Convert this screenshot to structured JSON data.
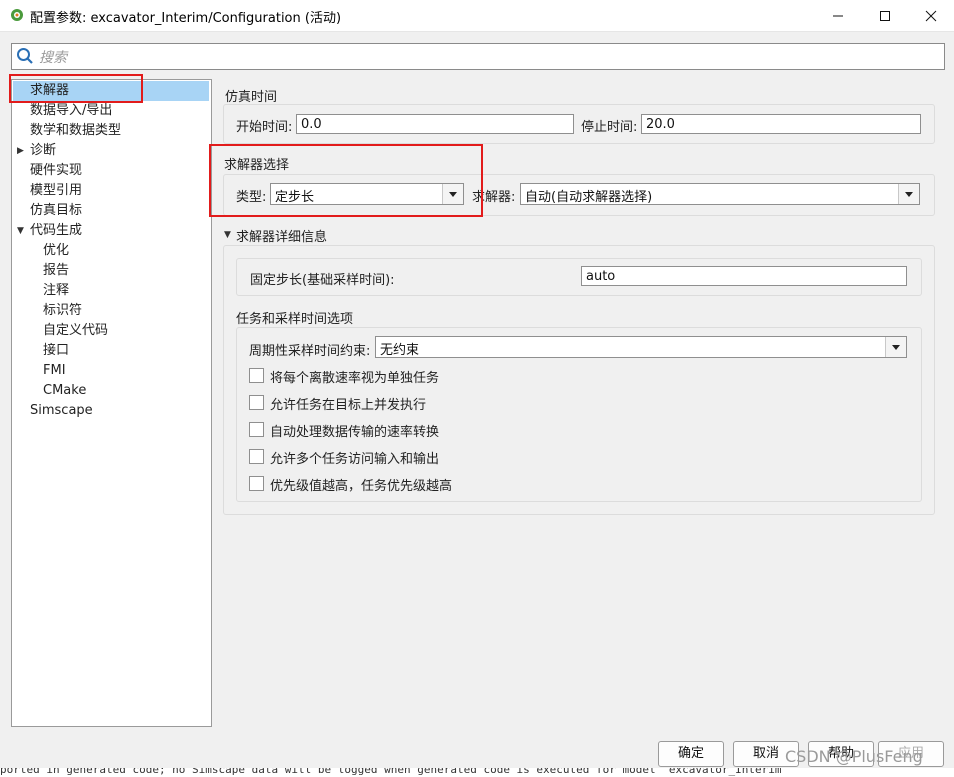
{
  "window": {
    "title": "配置参数: excavator_Interim/Configuration (活动)",
    "minimize_icon": "minimize-icon",
    "maximize_icon": "maximize-icon",
    "close_icon": "close-icon"
  },
  "search": {
    "placeholder": "搜索"
  },
  "tree": {
    "items": [
      {
        "label": "求解器"
      },
      {
        "label": "数据导入/导出"
      },
      {
        "label": "数学和数据类型"
      },
      {
        "label": "诊断"
      },
      {
        "label": "硬件实现"
      },
      {
        "label": "模型引用"
      },
      {
        "label": "仿真目标"
      },
      {
        "label": "代码生成"
      },
      {
        "label": "优化"
      },
      {
        "label": "报告"
      },
      {
        "label": "注释"
      },
      {
        "label": "标识符"
      },
      {
        "label": "自定义代码"
      },
      {
        "label": "接口"
      },
      {
        "label": "FMI"
      },
      {
        "label": "CMake"
      },
      {
        "label": "Simscape"
      }
    ]
  },
  "sim_time": {
    "heading": "仿真时间",
    "start_label": "开始时间:",
    "start_value": "0.0",
    "stop_label": "停止时间:",
    "stop_value": "20.0"
  },
  "solver_select": {
    "heading": "求解器选择",
    "type_label": "类型:",
    "type_value": "定步长",
    "solver_label": "求解器:",
    "solver_value": "自动(自动求解器选择)"
  },
  "solver_details": {
    "heading": "求解器详细信息",
    "fixed_step_label": "固定步长(基础采样时间):",
    "fixed_step_value": "auto"
  },
  "tasking": {
    "heading": "任务和采样时间选项",
    "periodic_label": "周期性采样时间约束:",
    "periodic_value": "无约束",
    "checkboxes": [
      {
        "label": "将每个离散速率视为单独任务",
        "checked": false
      },
      {
        "label": "允许任务在目标上并发执行",
        "checked": false
      },
      {
        "label": "自动处理数据传输的速率转换",
        "checked": false
      },
      {
        "label": "允许多个任务访问输入和输出",
        "checked": false
      },
      {
        "label": "优先级值越高，任务优先级越高",
        "checked": false
      }
    ]
  },
  "buttons": {
    "ok": "确定",
    "cancel": "取消",
    "help": "帮助",
    "apply": "应用"
  },
  "status_line": "ported in generated code; no Simscape data will be logged when generated code is executed for model 'excavator_Interim'",
  "watermark": "CSDN @PlusFeng",
  "colors": {
    "selection": "#a8d4f5",
    "highlight_box": "#e21b1b"
  }
}
